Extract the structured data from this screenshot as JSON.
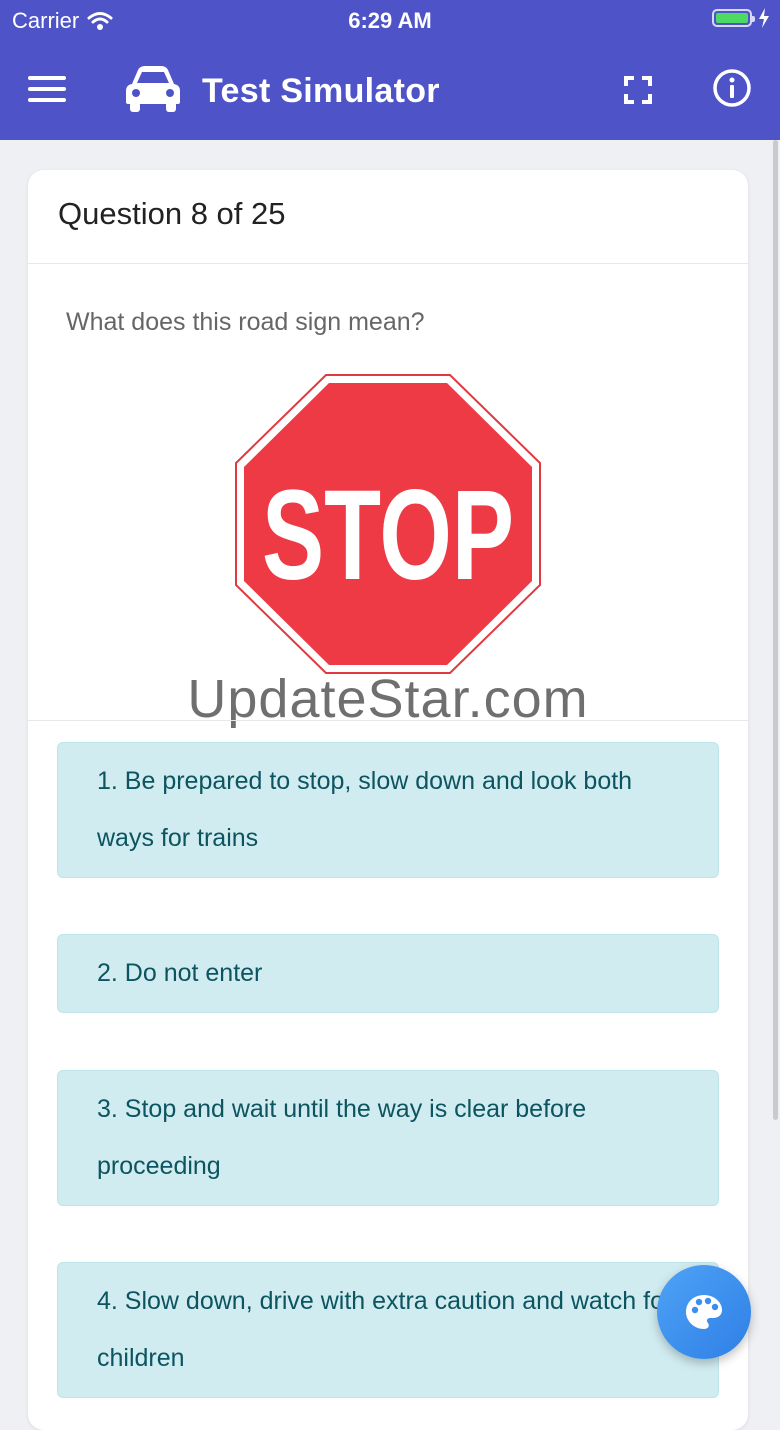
{
  "status": {
    "carrier": "Carrier",
    "time": "6:29 AM",
    "battery_percent": 100
  },
  "header": {
    "title": "Test Simulator",
    "accent_color": "#4e54c8"
  },
  "quiz": {
    "progress": "Question 8 of 25",
    "question": "What does this road sign mean?",
    "sign_text": "STOP",
    "watermark": "UpdateStar.com",
    "answers": [
      "1. Be prepared to stop, slow down and look both ways for trains",
      "2. Do not enter",
      "3. Stop and wait until the way is clear before proceeding",
      "4. Slow down, drive with extra caution and watch for children"
    ]
  },
  "icons": [
    "wifi-icon",
    "battery-icon",
    "charging-icon",
    "menu-icon",
    "car-icon",
    "fullscreen-icon",
    "info-icon",
    "palette-icon"
  ]
}
